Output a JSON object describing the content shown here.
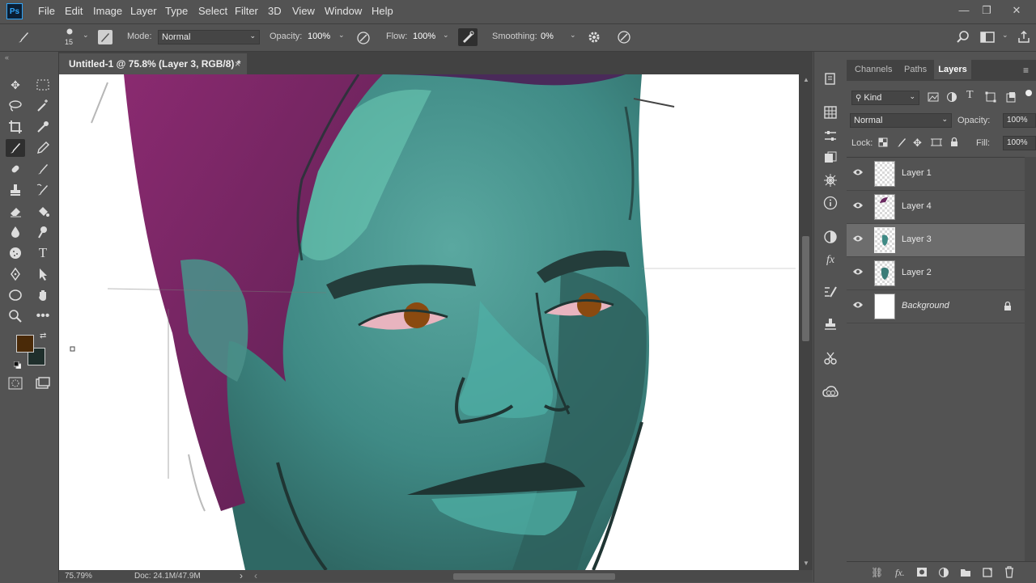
{
  "app": {
    "logo": "Ps"
  },
  "menu": [
    "File",
    "Edit",
    "Image",
    "Layer",
    "Type",
    "Select",
    "Filter",
    "3D",
    "View",
    "Window",
    "Help"
  ],
  "window_controls": {
    "minimize": "—",
    "restore": "❐",
    "close": "✕"
  },
  "options_bar": {
    "brush_size": "15",
    "mode_label": "Mode:",
    "mode_value": "Normal",
    "opacity_label": "Opacity:",
    "opacity_value": "100%",
    "flow_label": "Flow:",
    "flow_value": "100%",
    "smoothing_label": "Smoothing:",
    "smoothing_value": "0%"
  },
  "document": {
    "tab_title": "Untitled-1 @ 75.8% (Layer 3, RGB/8) *",
    "close": "×",
    "zoom": "75.79%",
    "doc_info": "Doc: 24.1M/47.9M"
  },
  "colors": {
    "foreground": "#4a2a08",
    "background": "#1f2f2c",
    "hair": "#7a2a6a",
    "skin": "#3f8a85",
    "eye": "#8a4a10"
  },
  "layers_panel": {
    "tabs": [
      "Channels",
      "Paths",
      "Layers"
    ],
    "active_tab": "Layers",
    "filter_label": "Kind",
    "blend_mode": "Normal",
    "opacity_label": "Opacity:",
    "opacity_value": "100%",
    "lock_label": "Lock:",
    "fill_label": "Fill:",
    "fill_value": "100%",
    "layers": [
      {
        "name": "Layer 1",
        "selected": false
      },
      {
        "name": "Layer 4",
        "selected": false
      },
      {
        "name": "Layer 3",
        "selected": true
      },
      {
        "name": "Layer 2",
        "selected": false
      },
      {
        "name": "Background",
        "selected": false,
        "locked": true
      }
    ]
  }
}
